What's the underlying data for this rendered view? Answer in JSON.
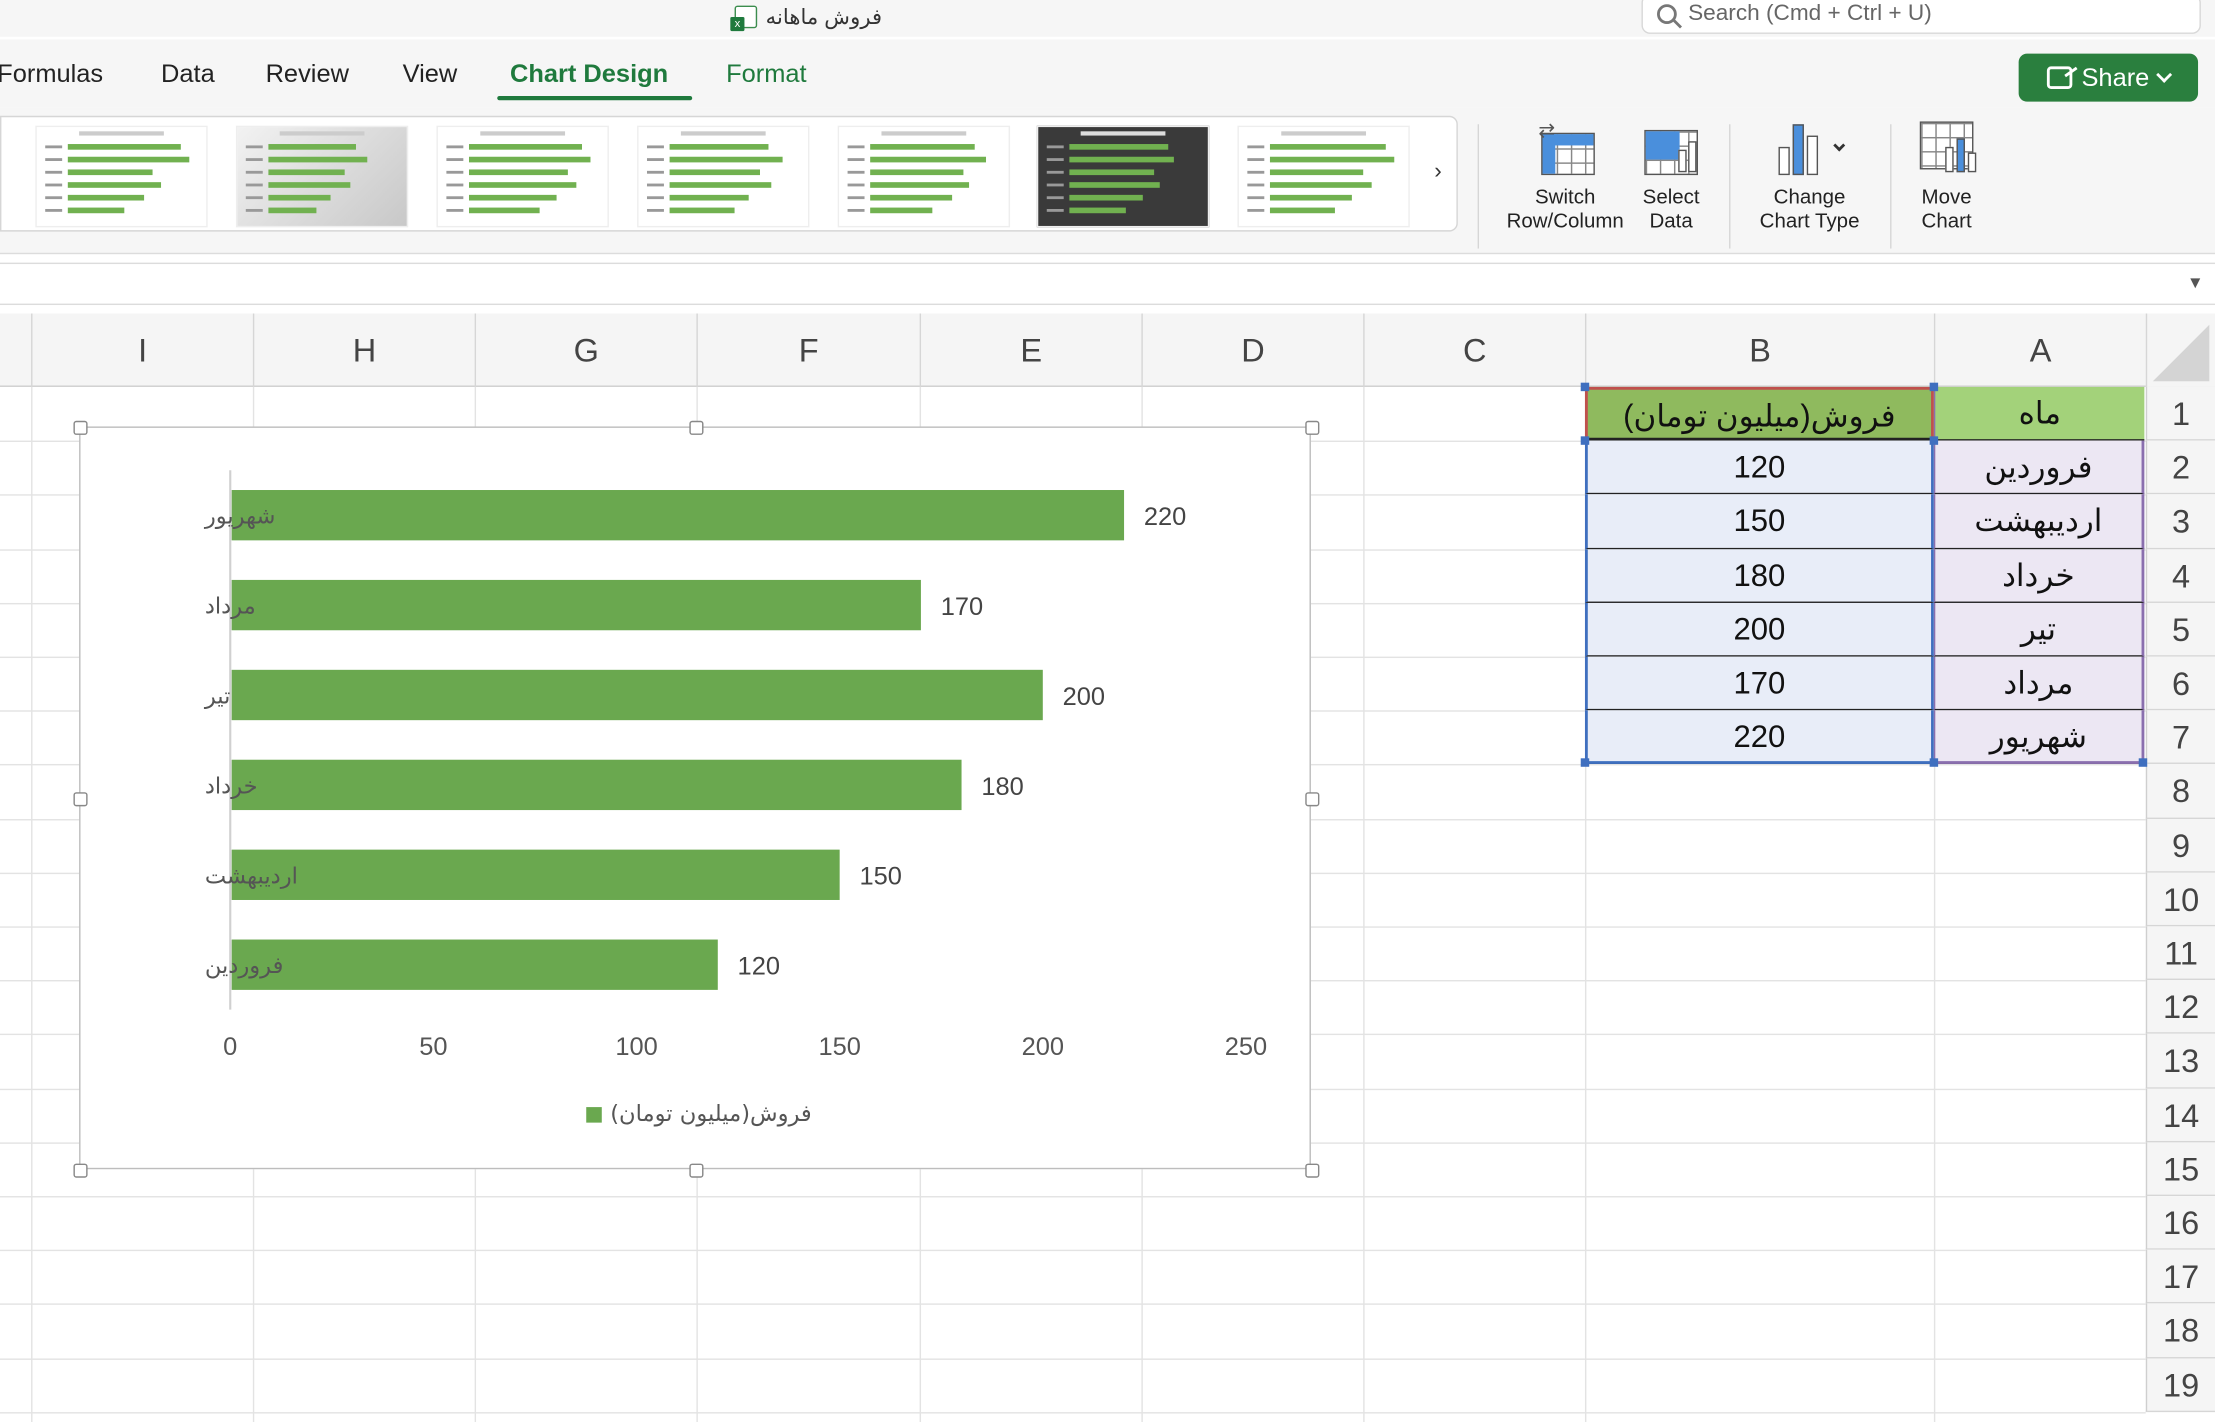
{
  "window": {
    "title": "فروش ماهانه"
  },
  "search": {
    "placeholder": "Search (Cmd + Ctrl + U)"
  },
  "tabs": [
    {
      "label": "Formulas"
    },
    {
      "label": "Data"
    },
    {
      "label": "Review"
    },
    {
      "label": "View"
    },
    {
      "label": "Chart Design",
      "active": true
    },
    {
      "label": "Format"
    }
  ],
  "share": {
    "label": "Share"
  },
  "ribbon": {
    "switch_row_column": {
      "line1": "Switch",
      "line2": "Row/Column"
    },
    "select_data": {
      "line1": "Select",
      "line2": "Data"
    },
    "change_chart_type": {
      "line1": "Change",
      "line2": "Chart Type"
    },
    "move_chart": {
      "line1": "Move",
      "line2": "Chart"
    }
  },
  "columns": [
    "I",
    "H",
    "G",
    "F",
    "E",
    "D",
    "C",
    "B",
    "A"
  ],
  "rows": [
    "1",
    "2",
    "3",
    "4",
    "5",
    "6",
    "7",
    "8",
    "9",
    "10",
    "11",
    "12",
    "13",
    "14",
    "15",
    "16",
    "17",
    "18",
    "19"
  ],
  "sheet": {
    "header_b": "فروش(میلیون تومان)",
    "header_a": "ماه",
    "data": [
      {
        "month": "فروردین",
        "value": "120"
      },
      {
        "month": "اردیبهشت",
        "value": "150"
      },
      {
        "month": "خرداد",
        "value": "180"
      },
      {
        "month": "تیر",
        "value": "200"
      },
      {
        "month": "مرداد",
        "value": "170"
      },
      {
        "month": "شهریور",
        "value": "220"
      }
    ]
  },
  "colors": {
    "accent": "#1f7a3d",
    "bar": "#6aa84f"
  },
  "chart_data": {
    "type": "bar",
    "orientation": "horizontal",
    "categories": [
      "فروردین",
      "اردیبهشت",
      "خرداد",
      "تیر",
      "مرداد",
      "شهریور"
    ],
    "series": [
      {
        "name": "فروش(میلیون تومان)",
        "values": [
          120,
          150,
          180,
          200,
          170,
          220
        ]
      }
    ],
    "xlim": [
      0,
      250
    ],
    "xticks": [
      0,
      50,
      100,
      150,
      200,
      250
    ],
    "grid": false,
    "legend": "bottom",
    "data_labels": true
  }
}
